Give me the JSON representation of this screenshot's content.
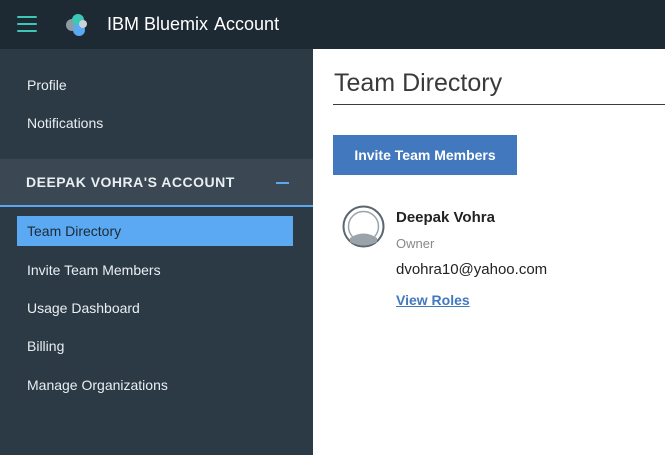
{
  "header": {
    "brand": "IBM Bluemix",
    "section": "Account",
    "accent_color": "#3cc7b6"
  },
  "sidebar": {
    "top_links": [
      {
        "label": "Profile"
      },
      {
        "label": "Notifications"
      }
    ],
    "account_section_title": "DEEPAK VOHRA'S ACCOUNT",
    "items": [
      {
        "label": "Team Directory",
        "active": true
      },
      {
        "label": "Invite Team Members"
      },
      {
        "label": "Usage Dashboard"
      },
      {
        "label": "Billing"
      },
      {
        "label": "Manage Organizations"
      }
    ],
    "active_color": "#5aa9f2"
  },
  "main": {
    "title": "Team Directory",
    "invite_button": "Invite Team Members",
    "member": {
      "name": "Deepak Vohra",
      "role": "Owner",
      "email": "dvohra10@yahoo.com",
      "view_roles": "View Roles"
    }
  }
}
